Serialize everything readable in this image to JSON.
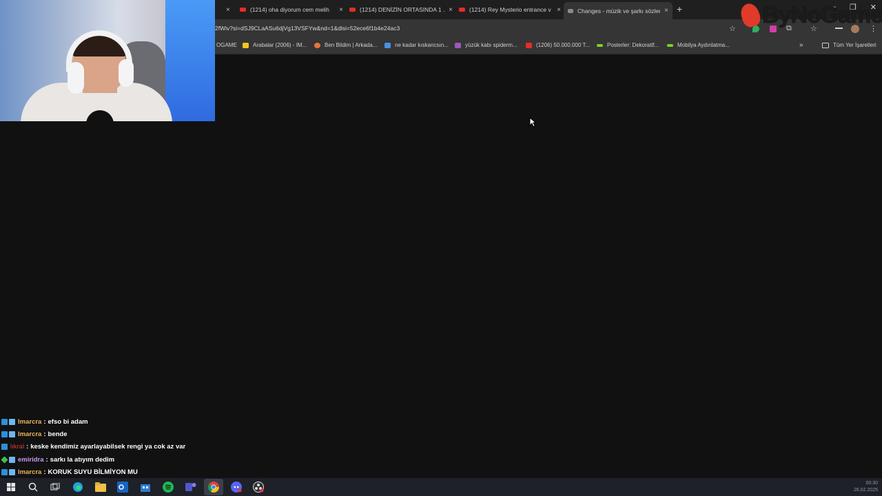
{
  "browser": {
    "tabs": [
      {
        "title": "(1214) oha diyorum cem melih",
        "close": "×"
      },
      {
        "title": "(1214) DENİZİN ORTASINDA 1 ...",
        "close": "×"
      },
      {
        "title": "(1214) Rey Mysterio entrance v",
        "close": "×"
      },
      {
        "title": "Changes - müzik ve şarkı sözleri",
        "close": "×",
        "active": true
      }
    ],
    "first_tab_close": "×",
    "new_tab": "+",
    "window_controls": [
      "—",
      "❐",
      "✕"
    ],
    "url": "2fWiv?si=dSJ9CLaASu6djVg13VSFYw&nd=1&dlsi=52ece6f1b4e24ac3",
    "toolbar_icons": {
      "star": "☆",
      "extensions": "⧉",
      "menu": "⋮"
    },
    "bookmarks": [
      {
        "label": "OGAME",
        "color": ""
      },
      {
        "label": "Arabalar (2006) - IM...",
        "color": "#f5c518"
      },
      {
        "label": "Ben Bildim | Arkada...",
        "color": "#e8743b"
      },
      {
        "label": "ne kadar kıskancsın...",
        "color": "#4a90e2"
      },
      {
        "label": "yüzük kabı spiderm...",
        "color": "#9b59b6"
      },
      {
        "label": "(1206) 50.000.000 T...",
        "color": "#e52d27"
      },
      {
        "label": "Posterler: Dekoratif...",
        "color": "#7ed321"
      },
      {
        "label": "Mobilya Aydınlatma...",
        "color": "#7ed321"
      }
    ],
    "bookmarks_more": "»",
    "all_bookmarks": "Tüm Yer İşaretleri"
  },
  "logo": {
    "brand": "By",
    "brand2": "NoGame"
  },
  "chat": [
    {
      "user": "lmarcra",
      "user_color": "#f0b35a",
      "message": "efso bi adam",
      "badges": [
        "b1",
        "b2"
      ]
    },
    {
      "user": "lmarcra",
      "user_color": "#f0b35a",
      "message": "bende",
      "badges": [
        "b1",
        "b2"
      ]
    },
    {
      "user": "lıkral",
      "user_color": "#e23b3b",
      "message": "keske kendimiz ayarlayabilsek rengi ya cok az var",
      "badges": [
        "b1"
      ]
    },
    {
      "user": "emiridra",
      "user_color": "#c59bf0",
      "message": "sarkı la atıyım dedim",
      "badges": [
        "b3",
        "b2"
      ]
    },
    {
      "user": "lmarcra",
      "user_color": "#f0b35a",
      "message": "KORUK SUYU BİLMİYON MU",
      "badges": [
        "b1",
        "b2"
      ]
    }
  ],
  "chat_separator": ":",
  "taskbar": {
    "icons": [
      "start-icon",
      "search-icon",
      "task-view-icon",
      "edge-icon",
      "file-explorer-icon",
      "outlook-icon",
      "store-icon",
      "spotify-icon",
      "teams-icon",
      "chrome-icon",
      "discord-icon",
      "obs-icon"
    ],
    "clock_time": "00:30",
    "clock_date": "26.02.2025"
  }
}
